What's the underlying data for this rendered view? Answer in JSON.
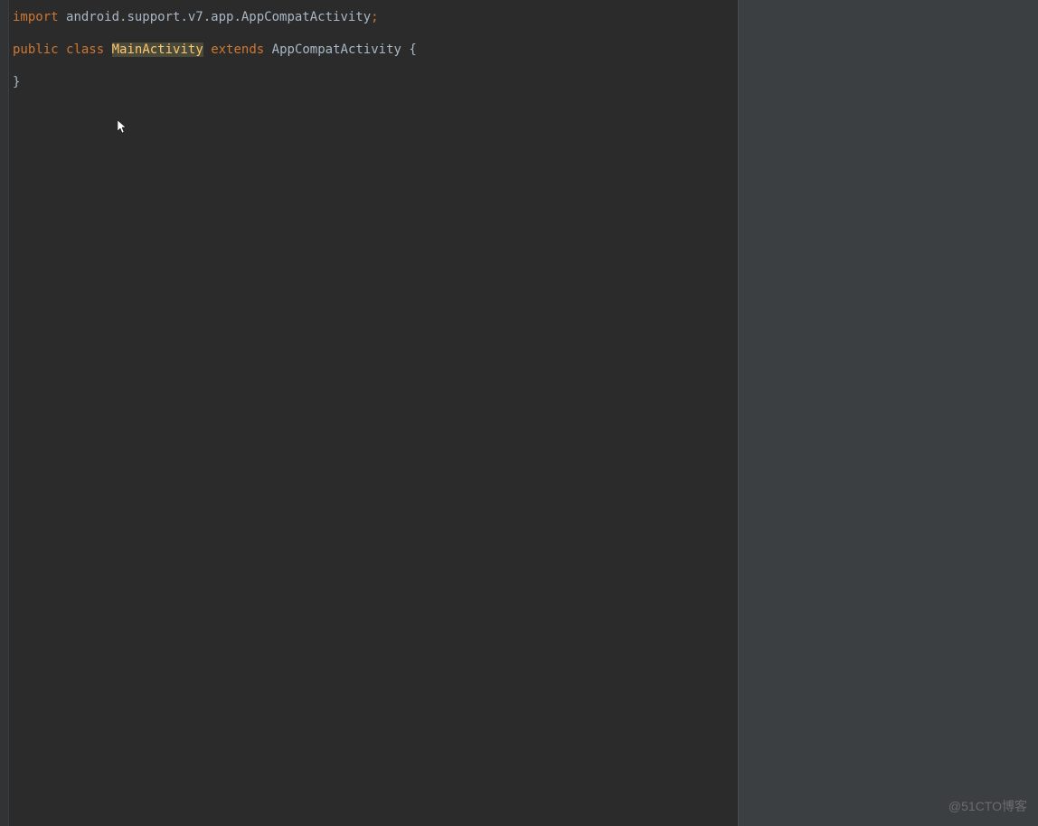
{
  "code": {
    "line1": {
      "keyword_import": "import",
      "package": "android.support.v7.app.AppCompatActivity",
      "semicolon": ";"
    },
    "line2": {
      "keyword_public": "public",
      "keyword_class": "class",
      "class_name": "MainActivity",
      "keyword_extends": "extends",
      "super_class": "AppCompatActivity",
      "brace_open": "{"
    },
    "line3": {
      "brace_close": "}"
    }
  },
  "watermark": "@51CTO博客"
}
